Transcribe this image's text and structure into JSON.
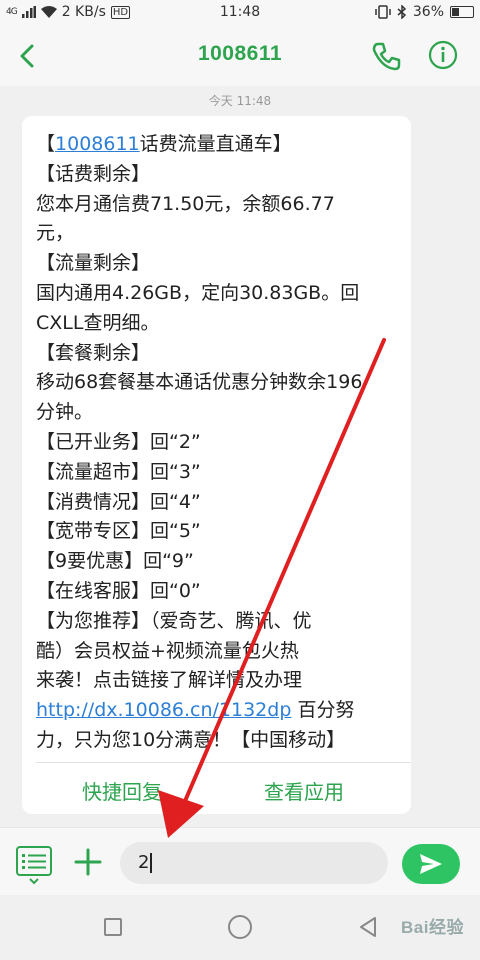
{
  "status_bar": {
    "signal": "4G",
    "speed": "2 KB/s",
    "volte": "HD",
    "time": "11:48",
    "battery": "36%"
  },
  "header": {
    "title": "1008611"
  },
  "conversation": {
    "timestamp": "今天 11:48",
    "message": {
      "number_link": "1008611",
      "lines": [
        "话费流量直通车】",
        "【话费剩余】",
        "您本月通信费71.50元，余额66.77",
        "元，",
        "【流量剩余】",
        "国内通用4.26GB，定向30.83GB。回",
        "CXLL查明细。",
        "【套餐剩余】",
        "移动68套餐基本通话优惠分钟数余196",
        "分钟。",
        "【已开业务】回“2”",
        "【流量超市】回“3”",
        "【消费情况】回“4”",
        "【宽带专区】回“5”",
        "【9要优惠】回“9”",
        "【在线客服】回“0”",
        "【为您推荐】（爱奇艺、腾讯、优",
        "酷）会员权益+视频流量包火热",
        "来袭！点击链接了解详情及办理"
      ],
      "link": "http://dx.10086.cn/1132dp",
      "link_suffix": " 百分努",
      "last_line": "力，只为您10分满意！【中国移动】"
    },
    "quick_reply": "快捷回复",
    "view_app": "查看应用"
  },
  "composer": {
    "input_value": "2"
  },
  "watermark": {
    "text": "Bai经验"
  },
  "colors": {
    "accent": "#2ea44f",
    "send": "#2ec463",
    "link": "#2d7fd6",
    "annotation_arrow": "#e02020"
  }
}
